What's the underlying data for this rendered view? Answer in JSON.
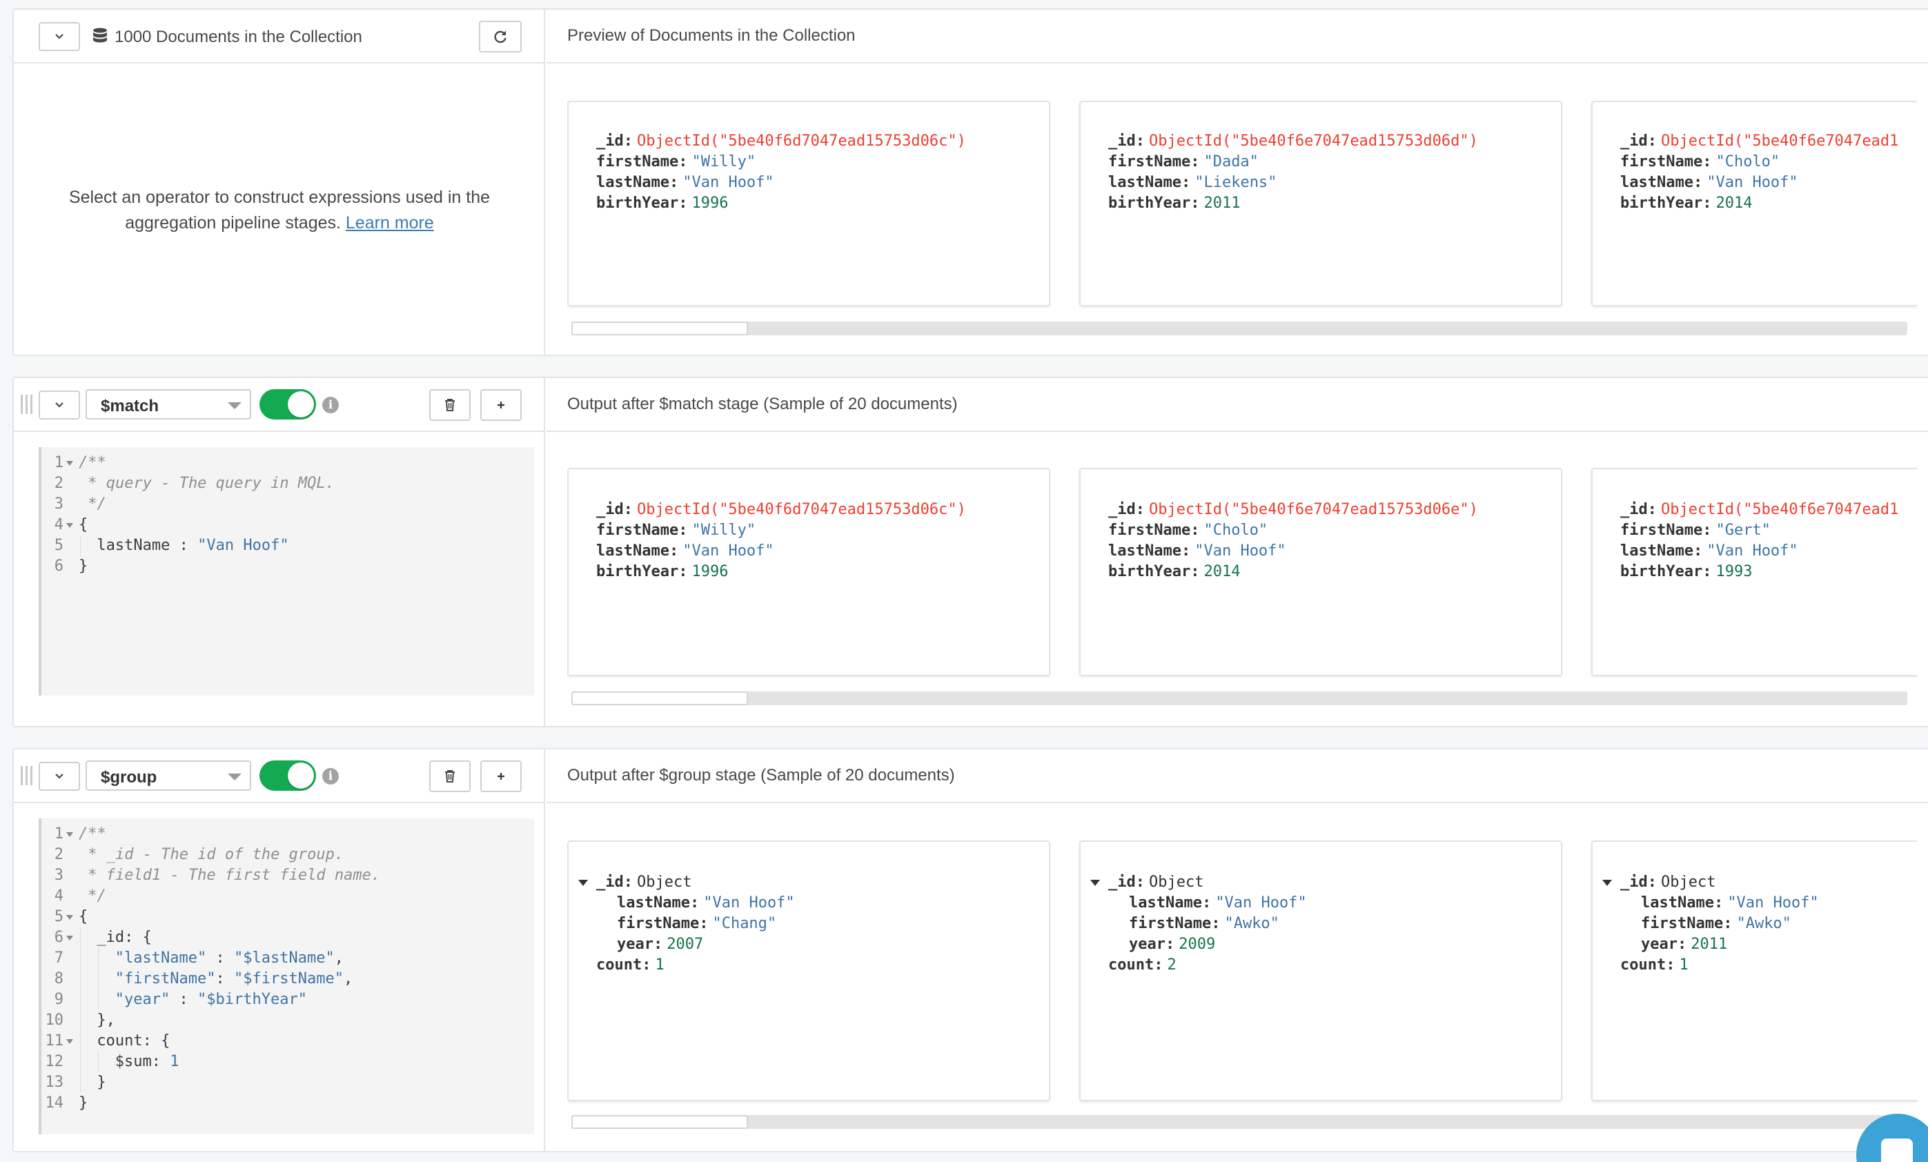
{
  "source": {
    "doc_count_label": "1000 Documents in the Collection",
    "preview_title": "Preview of Documents in the Collection",
    "helper_text_line1": "Select an operator to construct expressions used in the",
    "helper_text_line2": "aggregation pipeline stages.",
    "learn_more": "Learn more",
    "cards": [
      {
        "rows": [
          {
            "key": "_id:",
            "value": "ObjectId(\"5be40f6d7047ead15753d06c\")",
            "type": "oid"
          },
          {
            "key": "firstName:",
            "value": "\"Willy\"",
            "type": "str"
          },
          {
            "key": "lastName:",
            "value": "\"Van Hoof\"",
            "type": "str"
          },
          {
            "key": "birthYear:",
            "value": "1996",
            "type": "num"
          }
        ]
      },
      {
        "rows": [
          {
            "key": "_id:",
            "value": "ObjectId(\"5be40f6e7047ead15753d06d\")",
            "type": "oid"
          },
          {
            "key": "firstName:",
            "value": "\"Dada\"",
            "type": "str"
          },
          {
            "key": "lastName:",
            "value": "\"Liekens\"",
            "type": "str"
          },
          {
            "key": "birthYear:",
            "value": "2011",
            "type": "num"
          }
        ]
      },
      {
        "rows": [
          {
            "key": "_id:",
            "value": "ObjectId(\"5be40f6e7047ead1",
            "type": "oid"
          },
          {
            "key": "firstName:",
            "value": "\"Cholo\"",
            "type": "str"
          },
          {
            "key": "lastName:",
            "value": "\"Van Hoof\"",
            "type": "str"
          },
          {
            "key": "birthYear:",
            "value": "2014",
            "type": "num"
          }
        ]
      }
    ]
  },
  "match_stage": {
    "operator": "$match",
    "output_title": "Output after $match stage (Sample of 20 documents)",
    "code": [
      {
        "n": "1",
        "fold": true,
        "indent": 0,
        "parts": [
          {
            "t": "/**",
            "c": "com"
          }
        ]
      },
      {
        "n": "2",
        "fold": false,
        "indent": 0,
        "parts": [
          {
            "t": " * query - The query in MQL.",
            "c": "com"
          }
        ]
      },
      {
        "n": "3",
        "fold": false,
        "indent": 0,
        "parts": [
          {
            "t": " */",
            "c": "com"
          }
        ]
      },
      {
        "n": "4",
        "fold": true,
        "indent": 0,
        "parts": [
          {
            "t": "{",
            "c": "key"
          }
        ]
      },
      {
        "n": "5",
        "fold": false,
        "indent": 1,
        "parts": [
          {
            "t": "lastName",
            "c": "key"
          },
          {
            "t": " : ",
            "c": "key"
          },
          {
            "t": "\"Van Hoof\"",
            "c": "str"
          }
        ]
      },
      {
        "n": "6",
        "fold": false,
        "indent": 0,
        "parts": [
          {
            "t": "}",
            "c": "key"
          }
        ]
      }
    ],
    "cards": [
      {
        "rows": [
          {
            "key": "_id:",
            "value": "ObjectId(\"5be40f6d7047ead15753d06c\")",
            "type": "oid"
          },
          {
            "key": "firstName:",
            "value": "\"Willy\"",
            "type": "str"
          },
          {
            "key": "lastName:",
            "value": "\"Van Hoof\"",
            "type": "str"
          },
          {
            "key": "birthYear:",
            "value": "1996",
            "type": "num"
          }
        ]
      },
      {
        "rows": [
          {
            "key": "_id:",
            "value": "ObjectId(\"5be40f6e7047ead15753d06e\")",
            "type": "oid"
          },
          {
            "key": "firstName:",
            "value": "\"Cholo\"",
            "type": "str"
          },
          {
            "key": "lastName:",
            "value": "\"Van Hoof\"",
            "type": "str"
          },
          {
            "key": "birthYear:",
            "value": "2014",
            "type": "num"
          }
        ]
      },
      {
        "rows": [
          {
            "key": "_id:",
            "value": "ObjectId(\"5be40f6e7047ead1",
            "type": "oid"
          },
          {
            "key": "firstName:",
            "value": "\"Gert\"",
            "type": "str"
          },
          {
            "key": "lastName:",
            "value": "\"Van Hoof\"",
            "type": "str"
          },
          {
            "key": "birthYear:",
            "value": "1993",
            "type": "num"
          }
        ]
      }
    ]
  },
  "group_stage": {
    "operator": "$group",
    "output_title": "Output after $group stage (Sample of 20 documents)",
    "code": [
      {
        "n": "1",
        "fold": true,
        "indent": 0,
        "parts": [
          {
            "t": "/**",
            "c": "com"
          }
        ]
      },
      {
        "n": "2",
        "fold": false,
        "indent": 0,
        "parts": [
          {
            "t": " * _id - The id of the group.",
            "c": "com"
          }
        ]
      },
      {
        "n": "3",
        "fold": false,
        "indent": 0,
        "parts": [
          {
            "t": " * field1 - The first field name.",
            "c": "com"
          }
        ]
      },
      {
        "n": "4",
        "fold": false,
        "indent": 0,
        "parts": [
          {
            "t": " */",
            "c": "com"
          }
        ]
      },
      {
        "n": "5",
        "fold": true,
        "indent": 0,
        "parts": [
          {
            "t": "{",
            "c": "key"
          }
        ]
      },
      {
        "n": "6",
        "fold": true,
        "indent": 1,
        "parts": [
          {
            "t": "_id: {",
            "c": "key"
          }
        ]
      },
      {
        "n": "7",
        "fold": false,
        "indent": 2,
        "parts": [
          {
            "t": "\"lastName\"",
            "c": "str"
          },
          {
            "t": " : ",
            "c": "key"
          },
          {
            "t": "\"$lastName\"",
            "c": "str"
          },
          {
            "t": ",",
            "c": "key"
          }
        ]
      },
      {
        "n": "8",
        "fold": false,
        "indent": 2,
        "parts": [
          {
            "t": "\"firstName\"",
            "c": "str"
          },
          {
            "t": ": ",
            "c": "key"
          },
          {
            "t": "\"$firstName\"",
            "c": "str"
          },
          {
            "t": ",",
            "c": "key"
          }
        ]
      },
      {
        "n": "9",
        "fold": false,
        "indent": 2,
        "parts": [
          {
            "t": "\"year\"",
            "c": "str"
          },
          {
            "t": " : ",
            "c": "key"
          },
          {
            "t": "\"$birthYear\"",
            "c": "str"
          }
        ]
      },
      {
        "n": "10",
        "fold": false,
        "indent": 1,
        "parts": [
          {
            "t": "},",
            "c": "key"
          }
        ]
      },
      {
        "n": "11",
        "fold": true,
        "indent": 1,
        "parts": [
          {
            "t": "count: {",
            "c": "key"
          }
        ]
      },
      {
        "n": "12",
        "fold": false,
        "indent": 2,
        "parts": [
          {
            "t": "$sum",
            "c": "key"
          },
          {
            "t": ": ",
            "c": "key"
          },
          {
            "t": "1",
            "c": "num"
          }
        ]
      },
      {
        "n": "13",
        "fold": false,
        "indent": 1,
        "parts": [
          {
            "t": "}",
            "c": "key"
          }
        ]
      },
      {
        "n": "14",
        "fold": false,
        "indent": 0,
        "parts": [
          {
            "t": "}",
            "c": "key"
          }
        ]
      }
    ],
    "cards": [
      {
        "rows": [
          {
            "key": "_id:",
            "value": "Object",
            "type": "obj",
            "expand": true
          },
          {
            "key": "lastName:",
            "value": "\"Van Hoof\"",
            "type": "str",
            "nested": true
          },
          {
            "key": "firstName:",
            "value": "\"Chang\"",
            "type": "str",
            "nested": true
          },
          {
            "key": "year:",
            "value": "2007",
            "type": "num",
            "nested": true
          },
          {
            "key": "count:",
            "value": "1",
            "type": "num"
          }
        ]
      },
      {
        "rows": [
          {
            "key": "_id:",
            "value": "Object",
            "type": "obj",
            "expand": true
          },
          {
            "key": "lastName:",
            "value": "\"Van Hoof\"",
            "type": "str",
            "nested": true
          },
          {
            "key": "firstName:",
            "value": "\"Awko\"",
            "type": "str",
            "nested": true
          },
          {
            "key": "year:",
            "value": "2009",
            "type": "num",
            "nested": true
          },
          {
            "key": "count:",
            "value": "2",
            "type": "num"
          }
        ]
      },
      {
        "rows": [
          {
            "key": "_id:",
            "value": "Object",
            "type": "obj",
            "expand": true
          },
          {
            "key": "lastName:",
            "value": "\"Van Hoof\"",
            "type": "str",
            "nested": true
          },
          {
            "key": "firstName:",
            "value": "\"Awko\"",
            "type": "str",
            "nested": true
          },
          {
            "key": "year:",
            "value": "2011",
            "type": "num",
            "nested": true
          },
          {
            "key": "count:",
            "value": "1",
            "type": "num"
          }
        ]
      }
    ]
  },
  "colors": {
    "toggle_on": "#13aa52",
    "object_id": "#ee3f2f",
    "string": "#3f74a5",
    "number": "#16734a",
    "intercom": "#3ba3d5"
  },
  "icons": {
    "collapse": "chevron-down-icon",
    "refresh": "refresh-icon",
    "database": "database-icon",
    "delete": "trash-icon",
    "add": "plus-icon",
    "info": "info-icon",
    "drag": "drag-handle-icon"
  }
}
